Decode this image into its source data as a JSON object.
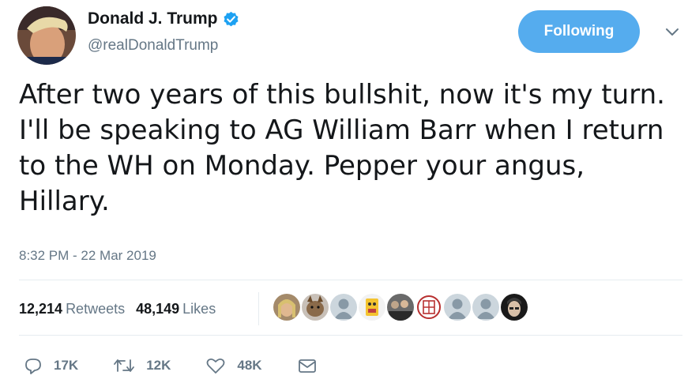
{
  "author": {
    "display_name": "Donald J. Trump",
    "handle": "@realDonaldTrump",
    "verified": true
  },
  "follow_button": {
    "label": "Following"
  },
  "tweet": {
    "text": "After two years of this bullshit, now it's my turn. I'll be speaking to AG William Barr when I return to the WH on Monday. Pepper your angus, Hillary.",
    "timestamp": "8:32 PM - 22 Mar 2019"
  },
  "stats": {
    "retweets_count": "12,214",
    "retweets_label": "Retweets",
    "likes_count": "48,149",
    "likes_label": "Likes"
  },
  "actions": {
    "reply_count": "17K",
    "retweet_count": "12K",
    "like_count": "48K"
  },
  "colors": {
    "accent": "#55acee",
    "verified": "#1da1f2",
    "muted": "#657786",
    "text": "#14171a",
    "divider": "#e6ecf0"
  },
  "icons": [
    "verified-badge-icon",
    "chevron-down-icon",
    "reply-icon",
    "retweet-icon",
    "like-icon",
    "direct-message-icon"
  ]
}
